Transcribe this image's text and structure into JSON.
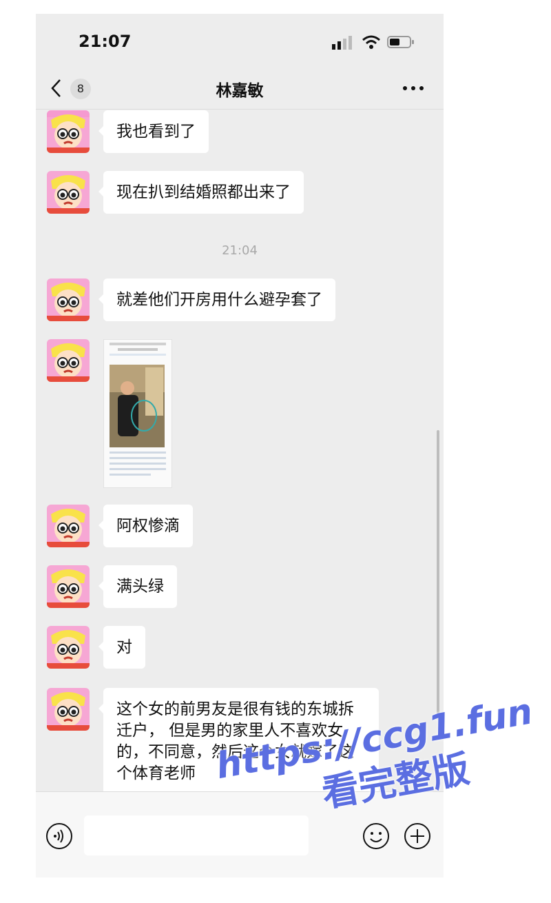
{
  "status_bar": {
    "time": "21:07",
    "signal_icon": "cellular-signal-icon",
    "wifi_icon": "wifi-icon",
    "battery_icon": "battery-icon"
  },
  "nav": {
    "back_icon": "chevron-left-icon",
    "unread_count": "8",
    "title": "林嘉敏",
    "more_icon": "more-dots-icon"
  },
  "messages": [
    {
      "type": "text",
      "text": "我也看到了"
    },
    {
      "type": "text",
      "text": "现在扒到结婚照都出来了"
    },
    {
      "type": "time",
      "text": "21:04"
    },
    {
      "type": "text",
      "text": "就差他们开房用什么避孕套了"
    },
    {
      "type": "image",
      "description_icon": "screenshot-thumbnail"
    },
    {
      "type": "text",
      "text": "阿权惨滴"
    },
    {
      "type": "text",
      "text": "满头绿"
    },
    {
      "type": "text",
      "text": "对"
    },
    {
      "type": "text",
      "text": "这个女的前男友是很有钱的东城拆迁户， 但是男的家里人不喜欢女的，不同意，然后这个女就嫁了这个体育老师"
    }
  ],
  "input_bar": {
    "voice_icon": "voice-input-icon",
    "input_value": "",
    "emoji_icon": "emoji-icon",
    "plus_icon": "plus-icon"
  },
  "watermark": {
    "url": "https://ccg1.fun",
    "caption": "看完整版"
  },
  "colors": {
    "background": "#ededed",
    "bubble": "#ffffff",
    "watermark": "#5b6ee1"
  }
}
